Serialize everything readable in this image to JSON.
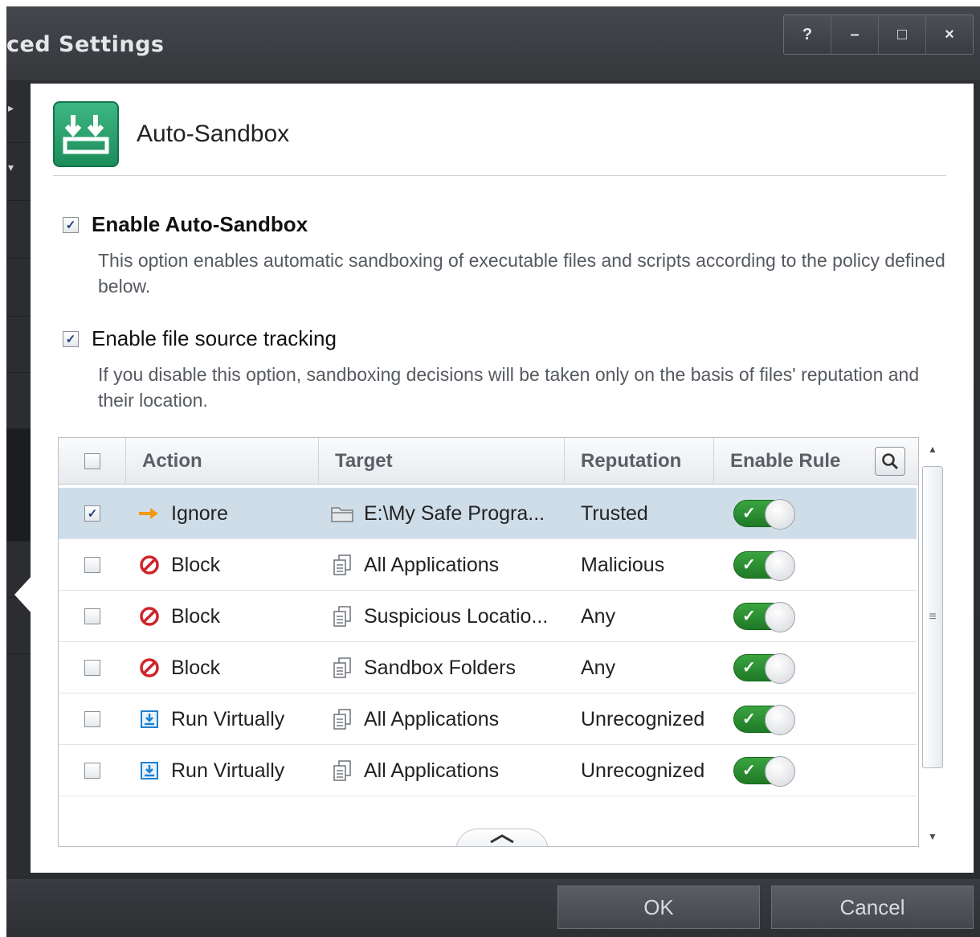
{
  "window": {
    "title": "ced Settings",
    "controls": {
      "help": "?",
      "minimize": "–",
      "maximize": "□",
      "close": "×"
    }
  },
  "header": {
    "title": "Auto-Sandbox",
    "icon": "auto-sandbox-icon"
  },
  "options": [
    {
      "label": "Enable Auto-Sandbox",
      "checked": true,
      "description": "This option enables automatic sandboxing of executable files and scripts according to the policy defined below."
    },
    {
      "label": "Enable file source tracking",
      "checked": true,
      "description": "If you disable this option, sandboxing decisions will be taken only on the basis of files' reputation and their location."
    }
  ],
  "table": {
    "columns": {
      "action": "Action",
      "target": "Target",
      "reputation": "Reputation",
      "enable_rule": "Enable Rule"
    },
    "rows": [
      {
        "selected": true,
        "action": "Ignore",
        "action_icon": "arrow-right-icon",
        "target": "E:\\My Safe Progra...",
        "target_icon": "folder-icon",
        "reputation": "Trusted",
        "enabled": true
      },
      {
        "selected": false,
        "action": "Block",
        "action_icon": "block-icon",
        "target": "All Applications",
        "target_icon": "file-group-icon",
        "reputation": "Malicious",
        "enabled": true
      },
      {
        "selected": false,
        "action": "Block",
        "action_icon": "block-icon",
        "target": "Suspicious Locatio...",
        "target_icon": "file-group-icon",
        "reputation": "Any",
        "enabled": true
      },
      {
        "selected": false,
        "action": "Block",
        "action_icon": "block-icon",
        "target": "Sandbox Folders",
        "target_icon": "file-group-icon",
        "reputation": "Any",
        "enabled": true
      },
      {
        "selected": false,
        "action": "Run Virtually",
        "action_icon": "run-virtually-icon",
        "target": "All Applications",
        "target_icon": "file-group-icon",
        "reputation": "Unrecognized",
        "enabled": true
      },
      {
        "selected": false,
        "action": "Run Virtually",
        "action_icon": "run-virtually-icon",
        "target": "All Applications",
        "target_icon": "file-group-icon",
        "reputation": "Unrecognized",
        "enabled": true
      }
    ]
  },
  "footer": {
    "ok_label": "OK",
    "cancel_label": "Cancel"
  },
  "colors": {
    "accent_green": "#2e9a36",
    "block_red": "#d0232a",
    "ignore_orange": "#f39a12",
    "selection": "#cfdde9"
  }
}
